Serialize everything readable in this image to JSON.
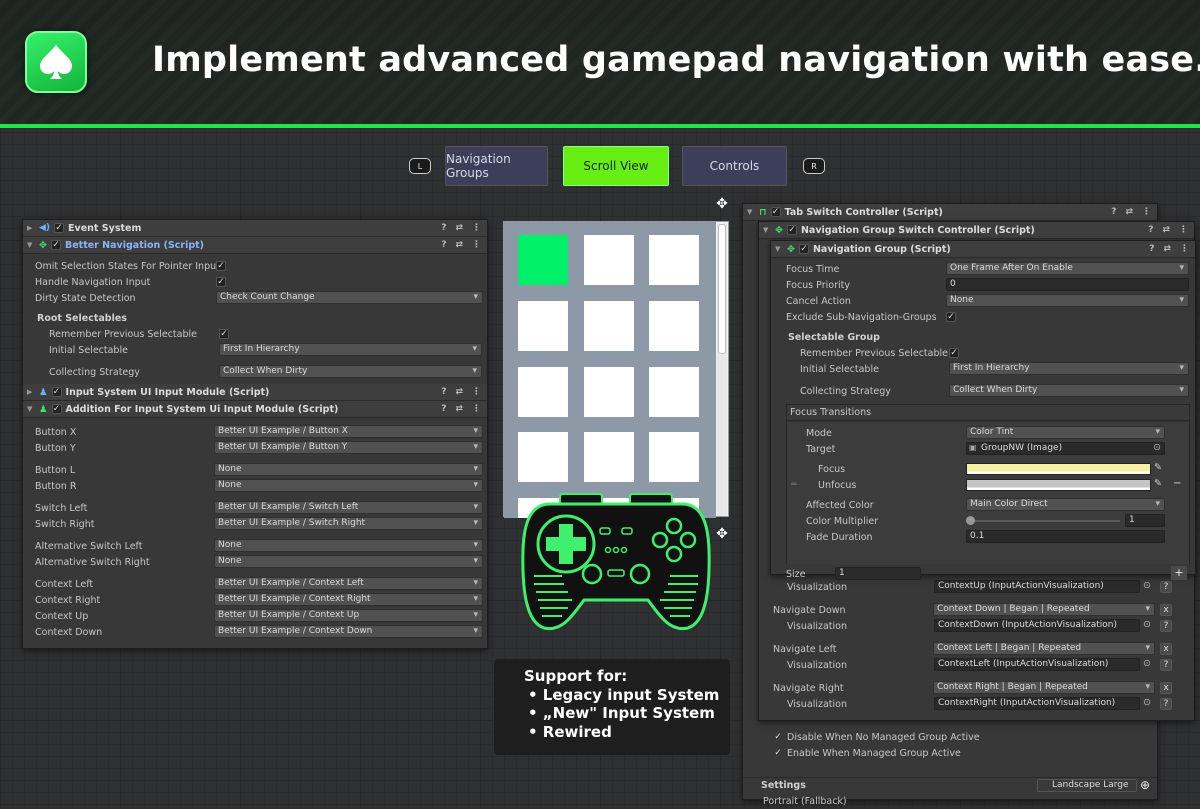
{
  "header": {
    "headline": "Implement advanced gamepad navigation with ease.",
    "logo_icon": "spade-icon",
    "accent_color": "#23e644"
  },
  "tabs": {
    "left_key": "L",
    "right_key": "R",
    "items": [
      "Navigation Groups",
      "Scroll View",
      "Controls"
    ],
    "active_index": 1
  },
  "left_inspector": {
    "event_system": "Event System",
    "better_navigation": "Better Navigation (Script)",
    "omit_selection": "Omit Selection States For Pointer Input",
    "handle_navigation": "Handle Navigation Input",
    "dirty_state_label": "Dirty State Detection",
    "dirty_state_value": "Check Count Change",
    "root_selectables": "Root Selectables",
    "remember_prev": "Remember Previous Selectable",
    "initial_selectable_label": "Initial Selectable",
    "initial_selectable_value": "First In Hierarchy",
    "collecting_label": "Collecting Strategy",
    "collecting_value": "Collect When Dirty",
    "input_module": "Input System UI Input Module (Script)",
    "addition_module": "Addition For Input System Ui Input Module (Script)",
    "bindings": [
      {
        "label": "Button X",
        "value": "Better UI Example / Button X"
      },
      {
        "label": "Button Y",
        "value": "Better UI Example / Button Y"
      },
      {
        "label": "Button L",
        "value": "None"
      },
      {
        "label": "Button R",
        "value": "None"
      },
      {
        "label": "Switch Left",
        "value": "Better UI Example / Switch Left"
      },
      {
        "label": "Switch Right",
        "value": "Better UI Example / Switch Right"
      },
      {
        "label": "Alternative Switch Left",
        "value": "None"
      },
      {
        "label": "Alternative Switch Right",
        "value": "None"
      },
      {
        "label": "Context Left",
        "value": "Better UI Example / Context Left"
      },
      {
        "label": "Context Right",
        "value": "Better UI Example / Context Right"
      },
      {
        "label": "Context Up",
        "value": "Better UI Example / Context Up"
      },
      {
        "label": "Context Down",
        "value": "Better UI Example / Context Down"
      }
    ]
  },
  "support": {
    "title": "Support for:",
    "items": [
      "• Legacy input System",
      "• „New\" Input System",
      "• Rewired"
    ]
  },
  "right_inspector": {
    "tab_switch": "Tab Switch Controller (Script)",
    "nav_group_switch": "Navigation Group Switch Controller (Script)",
    "nav_group": "Navigation Group (Script)",
    "focus_time_label": "Focus Time",
    "focus_time_value": "One Frame After On Enable",
    "focus_priority_label": "Focus Priority",
    "focus_priority_value": "0",
    "cancel_action_label": "Cancel Action",
    "cancel_action_value": "None",
    "exclude_sub": "Exclude Sub-Navigation-Groups",
    "selectable_group": "Selectable Group",
    "remember_prev": "Remember Previous Selectable",
    "initial_selectable_label": "Initial Selectable",
    "initial_selectable_value": "First In Hierarchy",
    "collecting_label": "Collecting Strategy",
    "collecting_value": "Collect When Dirty",
    "focus_transitions": "Focus Transitions",
    "mode_label": "Mode",
    "mode_value": "Color Tint",
    "target_label": "Target",
    "target_value": "GroupNW (Image)",
    "focus_label": "Focus",
    "unfocus_label": "Unfocus",
    "focus_color": "#f7f1a4",
    "unfocus_color": "#c4c4c4",
    "affected_label": "Affected Color",
    "affected_value": "Main Color Direct",
    "multiplier_label": "Color Multiplier",
    "multiplier_value": "1",
    "fade_label": "Fade Duration",
    "fade_value": "0.1",
    "size_label": "Size",
    "size_value": "1",
    "visualization_label": "Visualization",
    "viz_up": "ContextUp (InputActionVisualization)",
    "navigate_down_label": "Navigate Down",
    "navigate_down_value": "Context Down | Began | Repeated",
    "viz_down": "ContextDown (InputActionVisualization)",
    "navigate_left_label": "Navigate Left",
    "navigate_left_value": "Context Left | Began | Repeated",
    "viz_left": "ContextLeft (InputActionVisualization)",
    "navigate_right_label": "Navigate Right",
    "navigate_right_value": "Context Right | Began | Repeated",
    "viz_right": "ContextRight (InputActionVisualization)",
    "disable_when": "Disable When No Managed Group Active",
    "enable_when": "Enable When Managed Group Active",
    "settings_label": "Settings",
    "landscape": "Landscape Large",
    "portrait": "Portrait (Fallback)"
  }
}
